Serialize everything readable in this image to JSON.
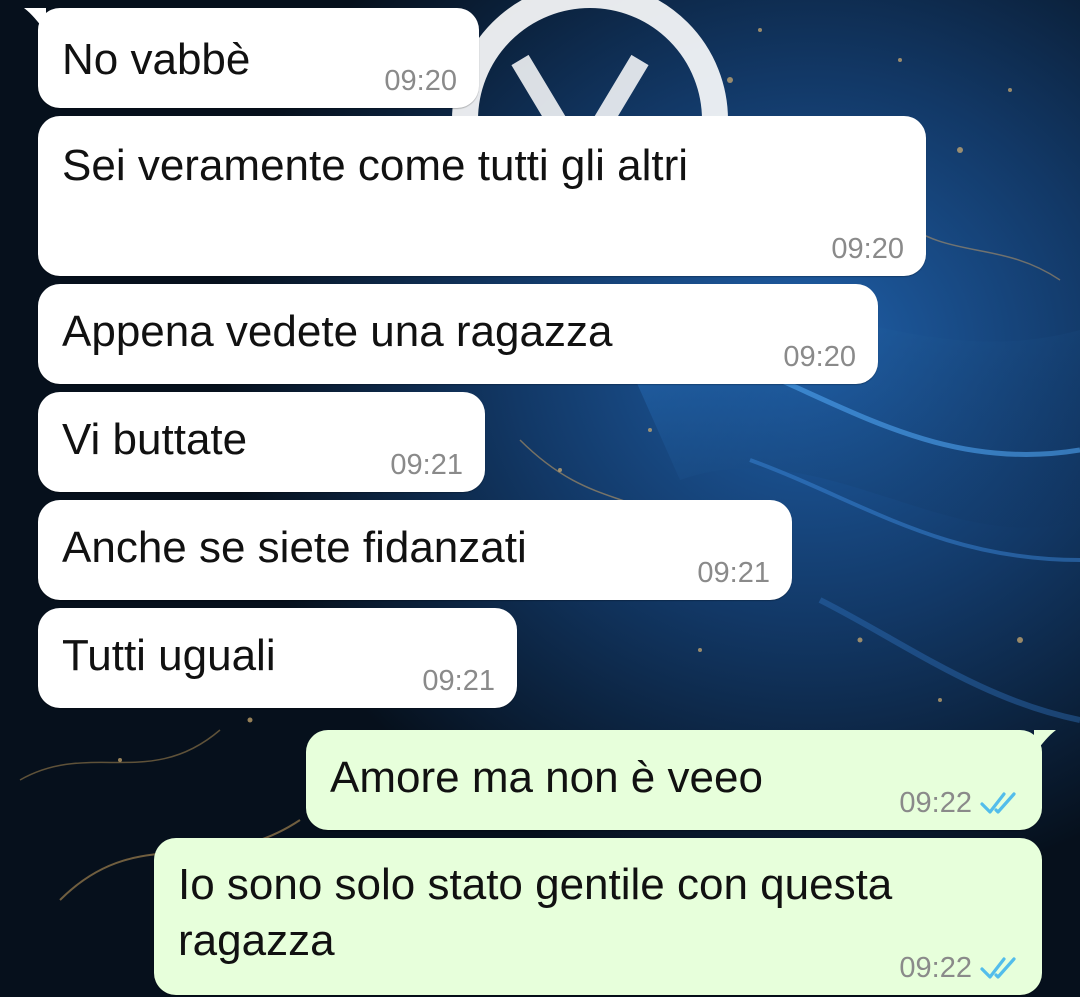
{
  "conversation": {
    "messages": [
      {
        "text": "No vabbè",
        "time": "09:20",
        "direction": "incoming"
      },
      {
        "text": "Sei veramente come tutti gli altri",
        "time": "09:20",
        "direction": "incoming"
      },
      {
        "text": "Appena vedete una ragazza",
        "time": "09:20",
        "direction": "incoming"
      },
      {
        "text": "Vi buttate",
        "time": "09:21",
        "direction": "incoming"
      },
      {
        "text": "Anche se siete fidanzati",
        "time": "09:21",
        "direction": "incoming"
      },
      {
        "text": "Tutti uguali",
        "time": "09:21",
        "direction": "incoming"
      },
      {
        "text": "Amore ma non è veeo",
        "time": "09:22",
        "direction": "outgoing",
        "status": "read"
      },
      {
        "text_line1": "Io sono solo stato gentile con questa",
        "text_line2": "ragazza",
        "time": "09:22",
        "direction": "outgoing",
        "status": "read"
      }
    ]
  },
  "colors": {
    "incoming_bubble": "#ffffff",
    "outgoing_bubble": "#e7ffdb",
    "read_ticks": "#53bdeb",
    "timestamp": "#8a8a8a"
  },
  "icons": {
    "read_receipt": "double-check-icon"
  }
}
